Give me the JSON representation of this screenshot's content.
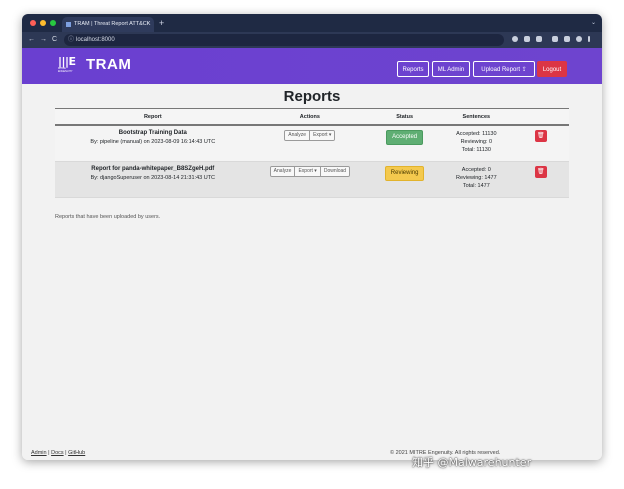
{
  "browser": {
    "tab_title": "TRAM | Threat Report ATT&CK",
    "new_tab": "+",
    "tab_close": "×",
    "url": "localhost:8000",
    "nav_back": "←",
    "nav_forward": "→",
    "nav_reload": "C"
  },
  "navbar": {
    "logo_sub": "MITRE ENGENUITY",
    "brand": "TRAM",
    "reports_label": "Reports",
    "ml_admin_label": "ML Admin",
    "upload_label": "Upload Report",
    "logout_label": "Logout"
  },
  "main": {
    "title": "Reports",
    "columns": [
      "Report",
      "Actions",
      "Status",
      "Sentences"
    ],
    "rows": [
      {
        "name": "Bootstrap Training Data",
        "by": "By: pipeline (manual) on 2023-08-09 16:14:43 UTC",
        "actions": [
          "Analyze",
          "Export ▾"
        ],
        "status": "Accepted",
        "accepted": "Accepted: 11130",
        "reviewing": "Reviewing: 0",
        "total": "Total: 11130"
      },
      {
        "name": "Report for panda-whitepaper_B8SZgeH.pdf",
        "by": "By: djangoSuperuser on 2023-08-14 21:31:43 UTC",
        "actions": [
          "Analyze",
          "Export ▾",
          "Download"
        ],
        "status": "Reviewing",
        "accepted": "Accepted: 0",
        "reviewing": "Reviewing: 1477",
        "total": "Total: 1477"
      }
    ],
    "caption": "Reports that have been uploaded by users."
  },
  "footer": {
    "admin": "Admin",
    "docs": "Docs",
    "github": "GitHub",
    "sep": "|",
    "copyright": "© 2021 MITRE Engenuity. All rights reserved."
  },
  "watermark": "知乎 @Malwarehunter",
  "colors": {
    "navbar": "#6a3fd0",
    "accepted": "#5fae73",
    "reviewing": "#f4c94e",
    "danger": "#dc3545"
  }
}
